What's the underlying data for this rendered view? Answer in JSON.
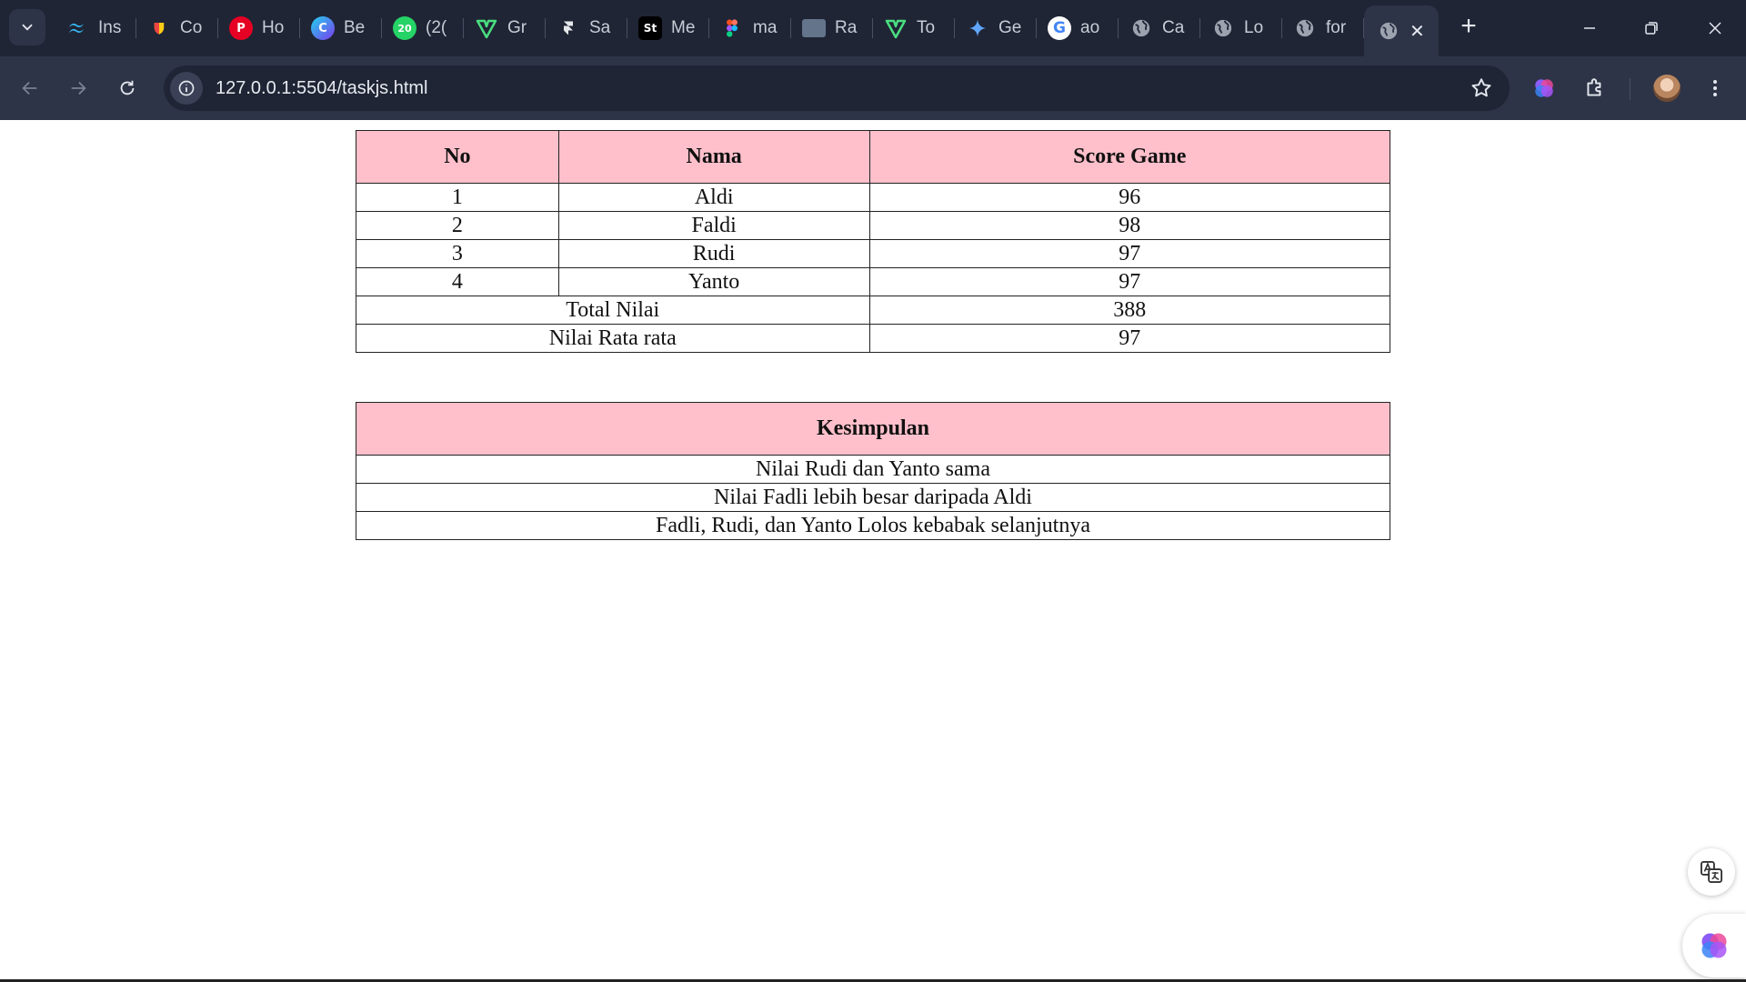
{
  "browser": {
    "tabs": [
      {
        "title": "Ins",
        "icon": "tailwind-icon",
        "color": "#38bdf8"
      },
      {
        "title": "Co",
        "icon": "shield-icon",
        "color": "#facc15"
      },
      {
        "title": "Ho",
        "icon": "pinterest-icon",
        "color": "#e60023"
      },
      {
        "title": "Be",
        "icon": "canva-icon",
        "color": "#3b82f6"
      },
      {
        "title": "(2(",
        "icon": "whatsapp-icon",
        "color": "#25d366",
        "badge": "20"
      },
      {
        "title": "Gr",
        "icon": "vuetify-icon",
        "color": "#22c55e"
      },
      {
        "title": "Sa",
        "icon": "framer-icon",
        "color": "#e5e7eb"
      },
      {
        "title": "Me",
        "icon": "stackblitz-icon",
        "color": "#111111",
        "badge": "St"
      },
      {
        "title": "ma",
        "icon": "figma-icon",
        "color": "#a259ff"
      },
      {
        "title": "Ra",
        "icon": "page-thumbnail-icon",
        "color": "#64748b"
      },
      {
        "title": "To",
        "icon": "vuetify-icon",
        "color": "#22c55e"
      },
      {
        "title": "Ge",
        "icon": "gemini-icon",
        "color": "#60a5fa"
      },
      {
        "title": "ao",
        "icon": "google-icon",
        "color": "#ffffff"
      },
      {
        "title": "Ca",
        "icon": "globe-icon",
        "color": "#9ca3af"
      },
      {
        "title": "Lo",
        "icon": "globe-icon",
        "color": "#9ca3af"
      },
      {
        "title": "for",
        "icon": "globe-icon",
        "color": "#9ca3af"
      }
    ],
    "url": "127.0.0.1:5504/taskjs.html"
  },
  "score_table": {
    "headers": [
      "No",
      "Nama",
      "Score Game"
    ],
    "rows": [
      {
        "no": "1",
        "nama": "Aldi",
        "score": "96"
      },
      {
        "no": "2",
        "nama": "Faldi",
        "score": "98"
      },
      {
        "no": "3",
        "nama": "Rudi",
        "score": "97"
      },
      {
        "no": "4",
        "nama": "Yanto",
        "score": "97"
      }
    ],
    "total_label": "Total Nilai",
    "total_value": "388",
    "average_label": "Nilai Rata rata",
    "average_value": "97"
  },
  "summary_table": {
    "header": "Kesimpulan",
    "rows": [
      "Nilai Rudi dan Yanto sama",
      "Nilai Fadli lebih besar daripada Aldi",
      "Fadli, Rudi, dan Yanto Lolos kebabak selanjutnya"
    ]
  }
}
